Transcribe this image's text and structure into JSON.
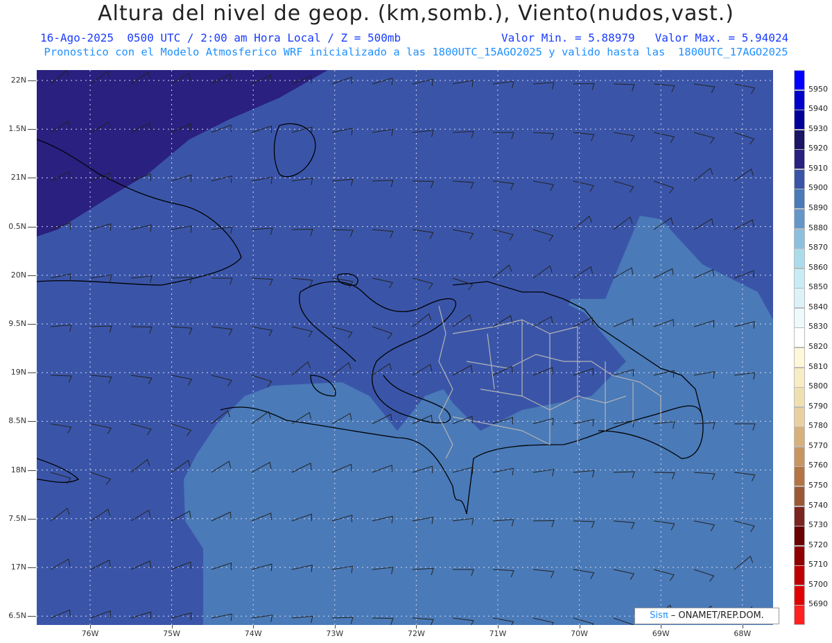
{
  "header": {
    "title": "Altura del nivel de geop. (km,somb.), Viento(nudos,vast.)",
    "date_line": "16-Ago-2025  0500 UTC / 2:00 am Hora Local / Z = 500mb",
    "min_value": "Valor Min. = 5.88979",
    "max_value": "Valor Max. = 5.94024",
    "model_line": "Pronostico con el Modelo Atmosferico WRF inicializado a las 1800UTC_15AGO2025 y valido hasta las  1800UTC_17AGO2025"
  },
  "axes": {
    "lat_labels": [
      "22N",
      "1.5N",
      "21N",
      "0.5N",
      "20N",
      "9.5N",
      "19N",
      "8.5N",
      "18N",
      "7.5N",
      "17N",
      "6.5N"
    ],
    "lon_labels": [
      "76W",
      "75W",
      "74W",
      "73W",
      "72W",
      "71W",
      "70W",
      "69W",
      "68W"
    ]
  },
  "colorbar": {
    "labels": [
      "5950",
      "5940",
      "5930",
      "5920",
      "5910",
      "5900",
      "5890",
      "5880",
      "5870",
      "5860",
      "5850",
      "5840",
      "5830",
      "5820",
      "5810",
      "5800",
      "5790",
      "5780",
      "5770",
      "5760",
      "5750",
      "5740",
      "5730",
      "5720",
      "5710",
      "5700",
      "5690"
    ],
    "colors": [
      "#0000ff",
      "#0000cc",
      "#000099",
      "#1c1464",
      "#2a2080",
      "#3a55a8",
      "#4a7ab8",
      "#6496c8",
      "#8cbede",
      "#aadcec",
      "#c8ecf4",
      "#dcf2f8",
      "#ecfafc",
      "#ffffff",
      "#fff8d8",
      "#f8ecc4",
      "#f0e0b0",
      "#e8d0a0",
      "#d8b07c",
      "#c89460",
      "#b47444",
      "#9c5834",
      "#7c2420",
      "#6a0000",
      "#900000",
      "#c00000",
      "#e00000",
      "#ff2020"
    ]
  },
  "map_colors": {
    "deep": "#2a2080",
    "mid": "#3a55a8",
    "light": "#4a7ab8",
    "coast": "#000000",
    "border": "#b4b4b4",
    "grid": "#d8d8e8"
  },
  "credit": {
    "sis": "Sisπ",
    "org": " – ONAMET/REP.DOM."
  }
}
